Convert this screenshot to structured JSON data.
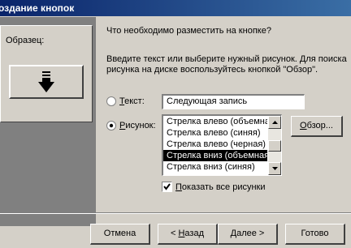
{
  "window": {
    "title": "оздание кнопок"
  },
  "sample": {
    "label": "Образец:",
    "icon": "down-arrow-icon"
  },
  "question": "Что необходимо разместить на кнопке?",
  "info": "Введите текст или выберите нужный рисунок.  Для поиска рисунка на диске воспользуйтесь кнопкой \"Обзор\".",
  "text_option": {
    "label_ul": "Т",
    "label_rest": "екст:",
    "selected": false,
    "value": "Следующая запись"
  },
  "picture_option": {
    "label_ul": "Р",
    "label_rest": "исунок:",
    "selected": true
  },
  "picture_list": {
    "items": [
      "Стрелка влево (объемная)",
      "Стрелка влево (синяя)",
      "Стрелка влево (черная)",
      "Стрелка вниз (объемная)",
      "Стрелка вниз (синяя)"
    ],
    "selected_index": 3
  },
  "browse_button": {
    "label_ul": "О",
    "label_rest": "бзор..."
  },
  "show_all": {
    "label_ul": "П",
    "label_rest": "оказать все рисунки",
    "checked": true
  },
  "buttons": {
    "cancel": "Отмена",
    "back_prefix": "< ",
    "back_ul": "Н",
    "back_rest": "азад",
    "next_ul": "Д",
    "next_rest": "алее >",
    "finish": "Готово"
  }
}
